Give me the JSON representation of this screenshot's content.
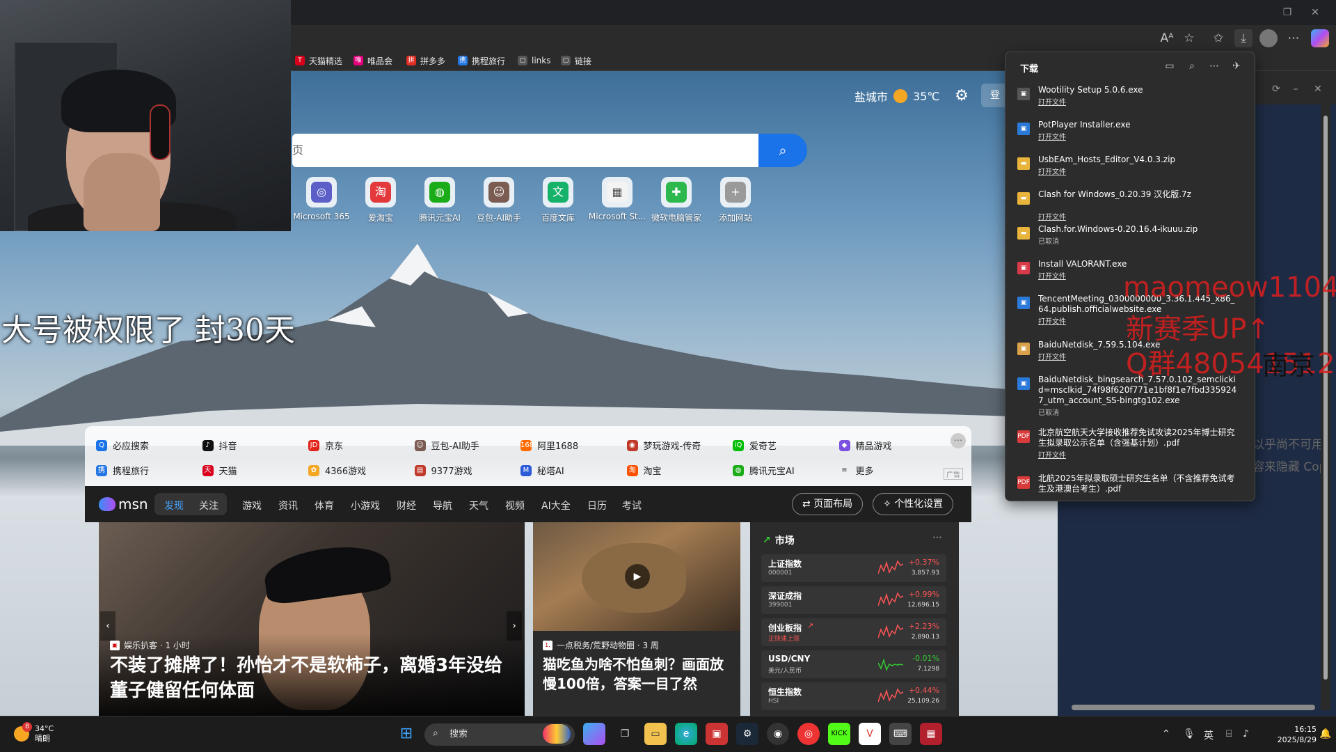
{
  "browser": {
    "favorites": [
      {
        "label": "天猫精选",
        "color": "#d9001b",
        "glyph": "T"
      },
      {
        "label": "唯品会",
        "color": "#e6007e",
        "glyph": "唯"
      },
      {
        "label": "拼多多",
        "color": "#e02e24",
        "glyph": "拼"
      },
      {
        "label": "携程旅行",
        "color": "#2577e3",
        "glyph": "携"
      },
      {
        "label": "links",
        "color": "#555555",
        "glyph": "▢"
      },
      {
        "label": "链接",
        "color": "#555555",
        "glyph": "▢"
      }
    ]
  },
  "newtab": {
    "weather": {
      "city": "盐城市",
      "temp": "35℃"
    },
    "login_label": "登",
    "search_placeholder": "页",
    "tiles": [
      {
        "label": "Microsoft 365",
        "color": "#5b5fc7",
        "glyph": "◎"
      },
      {
        "label": "爱淘宝",
        "color": "#e4393c",
        "glyph": "淘"
      },
      {
        "label": "腾讯元宝AI",
        "color": "#1aad19",
        "glyph": "◍"
      },
      {
        "label": "豆包-AI助手",
        "color": "#7a5c52",
        "glyph": "☺"
      },
      {
        "label": "百度文库",
        "color": "#17b26a",
        "glyph": "文"
      },
      {
        "label": "Microsoft St...",
        "color": "#f3f3f3",
        "glyph": "▦"
      },
      {
        "label": "微软电脑管家",
        "color": "#2db84d",
        "glyph": "✚"
      },
      {
        "label": "添加网站",
        "color": "#9a9a9a",
        "glyph": "+"
      }
    ],
    "quick_links": [
      {
        "label": "必应搜索",
        "color": "#1a73e8",
        "glyph": "Q"
      },
      {
        "label": "抖音",
        "color": "#111111",
        "glyph": "♪"
      },
      {
        "label": "京东",
        "color": "#e1251b",
        "glyph": "JD"
      },
      {
        "label": "豆包-AI助手",
        "color": "#7a5c52",
        "glyph": "☺"
      },
      {
        "label": "阿里1688",
        "color": "#ff6a00",
        "glyph": "1688"
      },
      {
        "label": "梦玩游戏-传奇",
        "color": "#c0392b",
        "glyph": "◉"
      },
      {
        "label": "爱奇艺",
        "color": "#00be06",
        "glyph": "iQ"
      },
      {
        "label": "精品游戏",
        "color": "#7b4fe0",
        "glyph": "◆"
      },
      {
        "label": "携程旅行",
        "color": "#2577e3",
        "glyph": "携"
      },
      {
        "label": "天猫",
        "color": "#d9001b",
        "glyph": "天"
      },
      {
        "label": "4366游戏",
        "color": "#f5a623",
        "glyph": "✿"
      },
      {
        "label": "9377游戏",
        "color": "#c0392b",
        "glyph": "▤"
      },
      {
        "label": "秘塔AI",
        "color": "#2d5bd8",
        "glyph": "M"
      },
      {
        "label": "淘宝",
        "color": "#ff5000",
        "glyph": "淘"
      },
      {
        "label": "腾讯元宝AI",
        "color": "#1aad19",
        "glyph": "◍"
      },
      {
        "label": "更多",
        "color": "transparent",
        "glyph": "≡"
      }
    ],
    "ad_label": "广告",
    "msn": {
      "logo": "msn",
      "tabs": [
        "发现",
        "关注",
        "游戏",
        "资讯",
        "体育",
        "小游戏",
        "财经",
        "导航",
        "天气",
        "视频",
        "AI大全",
        "日历",
        "考试"
      ],
      "layout_button": "页面布局",
      "personalize_button": "个性化设置"
    },
    "news": [
      {
        "source": "娱乐扒客 · 1 小时",
        "title": "不装了摊牌了！孙怡才不是软柿子，离婚3年没给董子健留任何体面"
      },
      {
        "source": "一点税务/荒野动物圈 · 3 周",
        "title": "猫吃鱼为啥不怕鱼刺？画面放慢100倍，答案一目了然"
      }
    ],
    "market": {
      "title": "市场",
      "rows": [
        {
          "name": "上证指数",
          "code": "000001",
          "change": "+0.37%",
          "value": "3,857.93",
          "up": true,
          "flag": false
        },
        {
          "name": "深证成指",
          "code": "399001",
          "change": "+0.99%",
          "value": "12,696.15",
          "up": true,
          "flag": false
        },
        {
          "name": "创业板指",
          "code": "正快速上涨",
          "change": "+2.23%",
          "value": "2,890.13",
          "up": true,
          "flag": true
        },
        {
          "name": "USD/CNY",
          "code": "美元/人民币",
          "change": "-0.01%",
          "value": "7.1298",
          "up": false,
          "flag": false
        },
        {
          "name": "恒生指数",
          "code": "HSI",
          "change": "+0.44%",
          "value": "25,109.26",
          "up": true,
          "flag": false
        }
      ]
    }
  },
  "downloads": {
    "title": "下载",
    "items": [
      {
        "name": "Wootility Setup 5.0.6.exe",
        "action": "打开文件",
        "icon": "exe",
        "color": "#555555"
      },
      {
        "name": "PotPlayer Installer.exe",
        "action": "打开文件",
        "icon": "exe",
        "color": "#2b79d8"
      },
      {
        "name": "UsbEAm_Hosts_Editor_V4.0.3.zip",
        "action": "打开文件",
        "icon": "zip",
        "color": "#e8b43c"
      },
      {
        "name": "Clash for Windows_0.20.39 汉化版.7z",
        "action": "打开文件",
        "icon": "zip",
        "color": "#e8b43c"
      },
      {
        "name": "Clash.for.Windows-0.20.16.4-ikuuu.zip",
        "action": "已取消",
        "icon": "zip",
        "color": "#e8b43c"
      },
      {
        "name": "Install VALORANT.exe",
        "action": "打开文件",
        "icon": "exe",
        "color": "#d93a4a"
      },
      {
        "name": "TencentMeeting_0300000000_3.36.1.445_x86_64.publish.officialwebsite.exe",
        "action": "打开文件",
        "icon": "exe",
        "color": "#2b79d8"
      },
      {
        "name": "BaiduNetdisk_7.59.5.104.exe",
        "action": "打开文件",
        "icon": "exe",
        "color": "#d9a24a"
      },
      {
        "name": "BaiduNetdisk_bingsearch_7.57.0.102_semclickid=msclkid_74f98f620f771e1bf8f1e7fbd3359247_utm_account_SS-bingtg102.exe",
        "action": "已取消",
        "icon": "exe",
        "color": "#2b79d8"
      },
      {
        "name": "北京航空航天大学接收推荐免试攻读2025年博士研究生拟录取公示名单（含强基计划）.pdf",
        "action": "打开文件",
        "icon": "pdf",
        "color": "#d93a3a"
      },
      {
        "name": "北航2025年拟录取硕士研究生名单（不含推荐免试考生及港澳台考生）.pdf",
        "action": "",
        "icon": "pdf",
        "color": "#d93a3a"
      }
    ]
  },
  "overlay": {
    "caption": "大号被权限了 封30天",
    "red_lines": [
      "maomeow1104",
      "新赛季UP↑",
      "Q群480541512"
    ],
    "black_text": "南京",
    "faint_lines": [
      "以乎尚不可用",
      "容来隐藏 Cop"
    ]
  },
  "taskbar": {
    "weather_badge": "8",
    "weather_temp": "34°C",
    "weather_desc": "晴朗",
    "search_placeholder": "搜索",
    "ime": "英",
    "time": "16:15",
    "date": "2025/8/29"
  }
}
